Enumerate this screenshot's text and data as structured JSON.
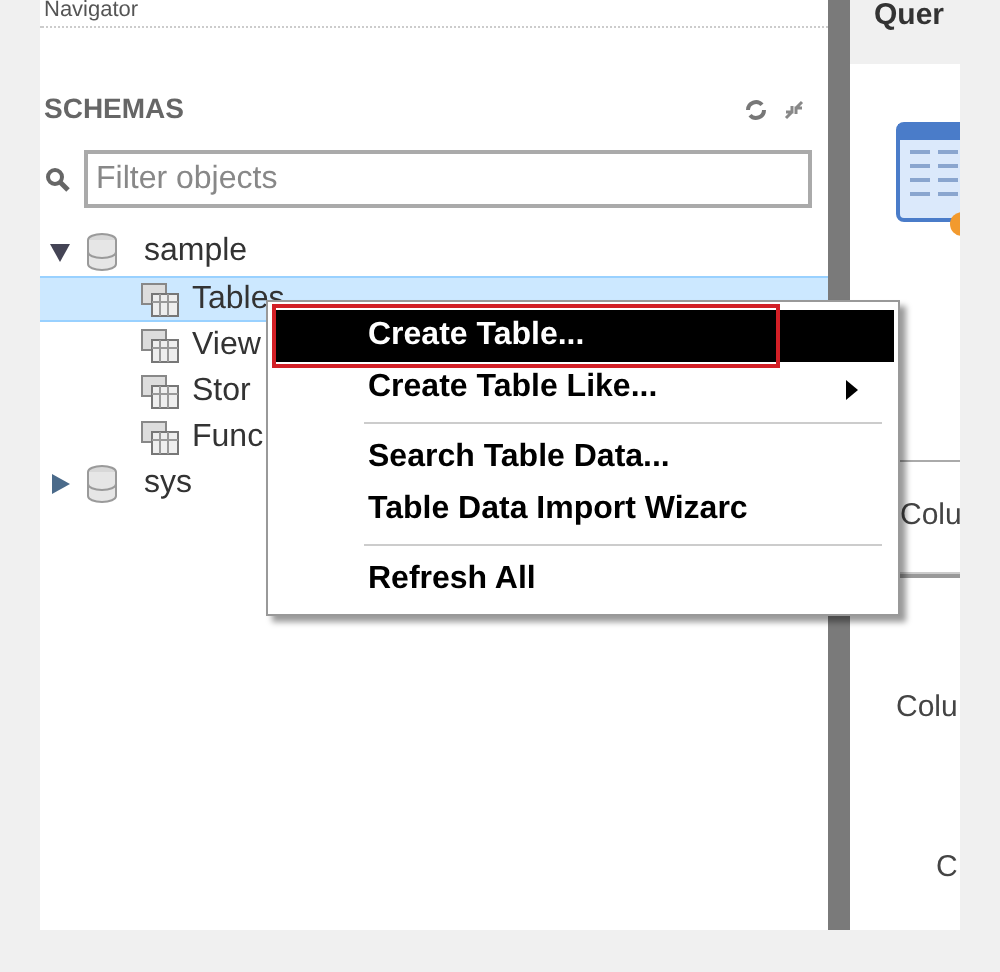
{
  "navigator": {
    "title": "Navigator",
    "section": "SCHEMAS",
    "filter": {
      "placeholder": "Filter objects"
    },
    "schemas": [
      {
        "name": "sample",
        "expanded": true,
        "children": [
          {
            "name": "Tables",
            "selected": true
          },
          {
            "name": "View",
            "selected": false
          },
          {
            "name": "Stor",
            "selected": false
          },
          {
            "name": "Func",
            "selected": false
          }
        ]
      },
      {
        "name": "sys",
        "expanded": false
      }
    ]
  },
  "context_menu": {
    "items": [
      {
        "kind": "item",
        "label": "Create Table...",
        "selected": true,
        "submenu": false
      },
      {
        "kind": "item",
        "label": "Create Table Like...",
        "selected": false,
        "submenu": true
      },
      {
        "kind": "separator"
      },
      {
        "kind": "item",
        "label": "Search Table Data...",
        "selected": false,
        "submenu": false
      },
      {
        "kind": "item",
        "label": "Table Data Import Wizarc",
        "selected": false,
        "submenu": false
      },
      {
        "kind": "separator"
      },
      {
        "kind": "item",
        "label": "Refresh All",
        "selected": false,
        "submenu": false
      }
    ]
  },
  "query_panel": {
    "title": "Quer",
    "labels": [
      "Colu",
      "Colu",
      "C"
    ]
  }
}
